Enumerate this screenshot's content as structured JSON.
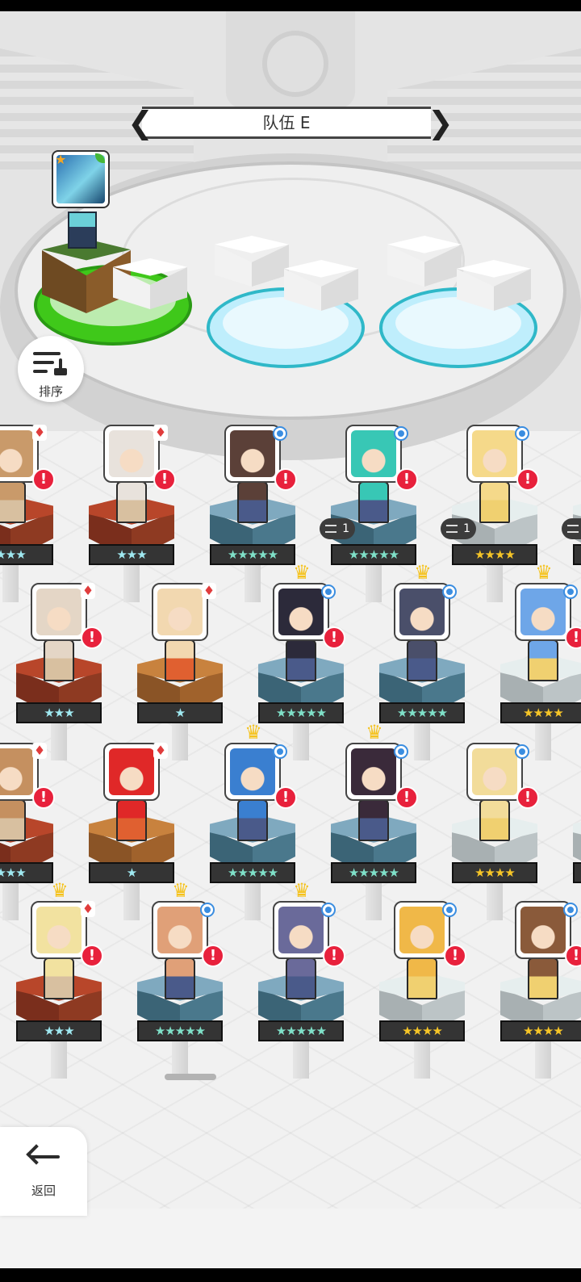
{
  "team": {
    "title": "队伍 E",
    "prev_label": "❮",
    "next_label": "❯"
  },
  "sort": {
    "label": "排序"
  },
  "back": {
    "label": "返回"
  },
  "rows": [
    [
      {
        "stars": "★★★",
        "tier": "brown",
        "portrait": "#c99a6a",
        "badge": "suit",
        "alert": true
      },
      {
        "stars": "★★★",
        "tier": "brown",
        "portrait": "#e8e2dc",
        "badge": "suit",
        "alert": true
      },
      {
        "stars": "★★★★★",
        "tier": "blue",
        "portrait": "#5b4038",
        "badge": "gem",
        "alert": true
      },
      {
        "stars": "★★★★★",
        "tier": "blue",
        "portrait": "#38c7b5",
        "badge": "gem",
        "alert": true,
        "count": "1"
      },
      {
        "stars": "★★★★",
        "tier": "gray",
        "portrait": "#f5d98a",
        "badge": "gem",
        "alert": true,
        "count": "1"
      },
      {
        "stars": "★★★★",
        "tier": "gray",
        "portrait": "#d9d9d9",
        "badge": "none",
        "alert": false,
        "count": "1"
      }
    ],
    [
      {
        "stars": "★★★",
        "tier": "brown",
        "portrait": "#e4d6c6",
        "badge": "suit",
        "alert": true
      },
      {
        "stars": "★",
        "tier": "ltbrown",
        "portrait": "#f2d8b0",
        "badge": "suit",
        "alert": false
      },
      {
        "stars": "★★★★★",
        "tier": "blue",
        "portrait": "#2c2a3a",
        "badge": "gem",
        "alert": true,
        "crown": true
      },
      {
        "stars": "★★★★★",
        "tier": "blue",
        "portrait": "#4a4f6a",
        "badge": "gem",
        "alert": false,
        "crown": true
      },
      {
        "stars": "★★★★",
        "tier": "gray",
        "portrait": "#6ea6e8",
        "badge": "gem",
        "alert": true,
        "crown": true
      }
    ],
    [
      {
        "stars": "★★★",
        "tier": "brown",
        "portrait": "#c59060",
        "badge": "suit",
        "alert": true
      },
      {
        "stars": "★",
        "tier": "ltbrown",
        "portrait": "#e02828",
        "badge": "suit",
        "alert": false
      },
      {
        "stars": "★★★★★",
        "tier": "blue",
        "portrait": "#3a7fd0",
        "badge": "gem",
        "alert": true,
        "crown": true
      },
      {
        "stars": "★★★★★",
        "tier": "blue",
        "portrait": "#3a2a3a",
        "badge": "gem",
        "alert": true,
        "crown": true
      },
      {
        "stars": "★★★★",
        "tier": "gray",
        "portrait": "#f2dc9a",
        "badge": "gem",
        "alert": true
      },
      {
        "stars": "★★★★",
        "tier": "gray",
        "portrait": "#d9d9d9",
        "badge": "none",
        "alert": false
      }
    ],
    [
      {
        "stars": "★★★",
        "tier": "brown",
        "portrait": "#f2e2a0",
        "badge": "suit",
        "alert": true,
        "crown": true
      },
      {
        "stars": "★★★★★",
        "tier": "blue",
        "portrait": "#e0a078",
        "badge": "gem",
        "alert": true,
        "crown": true
      },
      {
        "stars": "★★★★★",
        "tier": "blue",
        "portrait": "#6a6a9a",
        "badge": "gem",
        "alert": true,
        "crown": true
      },
      {
        "stars": "★★★★",
        "tier": "gray",
        "portrait": "#f0b848",
        "badge": "gem",
        "alert": true
      },
      {
        "stars": "★★★★",
        "tier": "gray",
        "portrait": "#8a5a3a",
        "badge": "gem",
        "alert": true
      }
    ]
  ],
  "colors": {
    "alert": "#e8213c",
    "gem": "#3a8de0",
    "crown": "#f5c21b",
    "star_gold": "#f6c527",
    "slot_green": "#3fc81a",
    "slot_blue": "#bfeefc"
  }
}
